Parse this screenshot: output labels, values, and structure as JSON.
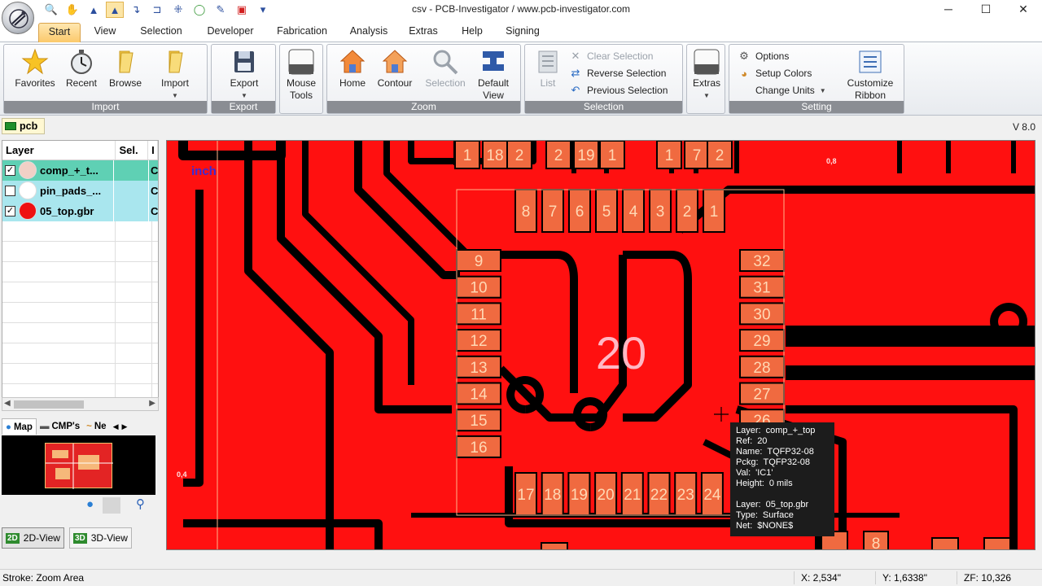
{
  "window": {
    "title": "csv - PCB-Investigator  /  www.pcb-investigator.com",
    "controls": {
      "minimize": "─",
      "maximize": "☐",
      "close": "✕"
    }
  },
  "quick_access": [
    {
      "name": "zoom-icon",
      "glyph": "🔍"
    },
    {
      "name": "pan-hand-icon",
      "glyph": "✋"
    },
    {
      "name": "arrow-up-icon",
      "glyph": "▲"
    },
    {
      "name": "select-arrow-icon",
      "glyph": "▲"
    },
    {
      "name": "route-icon",
      "glyph": "↴"
    },
    {
      "name": "measure-icon",
      "glyph": "⊐"
    },
    {
      "name": "pad-icon",
      "glyph": "⁜"
    },
    {
      "name": "circle-icon",
      "glyph": "◯"
    },
    {
      "name": "pen-icon",
      "glyph": "✎"
    },
    {
      "name": "pdf-icon",
      "glyph": "▣"
    },
    {
      "name": "customize-qat-icon",
      "glyph": "▾"
    }
  ],
  "ribbon_tabs": [
    "Start",
    "View",
    "Selection",
    "Developer",
    "Fabrication",
    "Analysis",
    "Extras",
    "Help",
    "Signing"
  ],
  "ribbon": {
    "import_group": {
      "caption": "Import",
      "favorites": "Favorites",
      "recent": "Recent",
      "browse": "Browse",
      "import": "Import"
    },
    "export_group": {
      "caption": "Export",
      "export": "Export"
    },
    "mouse_group": {
      "line1": "Mouse",
      "line2": "Tools"
    },
    "zoom_group": {
      "caption": "Zoom",
      "home": "Home",
      "contour": "Contour",
      "selection": "Selection",
      "default_view_1": "Default",
      "default_view_2": "View"
    },
    "selection_group": {
      "caption": "Selection",
      "list": "List",
      "clear": "Clear Selection",
      "reverse": "Reverse Selection",
      "previous": "Previous Selection"
    },
    "extras_group": {
      "extras": "Extras"
    },
    "setting_group": {
      "caption": "Setting",
      "options": "Options",
      "setup_colors": "Setup Colors",
      "change_units": "Change Units",
      "customize_1": "Customize",
      "customize_2": "Ribbon"
    }
  },
  "doc_tab": "pcb",
  "version": "V 8.0",
  "layer_grid": {
    "headers": [
      "Layer",
      "Sel.",
      "I"
    ],
    "rows": [
      {
        "checked": true,
        "name": "comp_+_t...",
        "sel": "",
        "i": "C",
        "color": "#f0d0c6",
        "row_bg": "#5fd0b4"
      },
      {
        "checked": false,
        "name": "pin_pads_...",
        "sel": "",
        "i": "C",
        "color": "#ffffff",
        "row_bg": "#a9e6ee"
      },
      {
        "checked": true,
        "name": "05_top.gbr",
        "sel": "",
        "i": "C",
        "color": "#ee1111",
        "row_bg": "#a9e6ee"
      }
    ]
  },
  "panel_tabs": [
    "Map",
    "CMP's",
    "Ne"
  ],
  "view_buttons": [
    {
      "icon": "2D",
      "label": "2D-View"
    },
    {
      "icon": "3D",
      "label": "3D-View"
    }
  ],
  "canvas": {
    "unit_label": "inch",
    "scale_labels": [
      "0,8",
      "0,4"
    ],
    "component_ref": "20",
    "pins_top": [
      "8",
      "7",
      "6",
      "5",
      "4",
      "3",
      "2",
      "1"
    ],
    "pins_left": [
      "9",
      "10",
      "11",
      "12",
      "13",
      "14",
      "15",
      "16"
    ],
    "pins_bottom": [
      "17",
      "18",
      "19",
      "20",
      "21",
      "22",
      "23",
      "24"
    ],
    "pins_right": [
      "32",
      "31",
      "30",
      "29",
      "28",
      "27",
      "26"
    ],
    "upper_pads": [
      "1",
      "18",
      "2",
      "2",
      "19",
      "1",
      "1",
      "7",
      "2"
    ],
    "lower_pads": [
      "8"
    ]
  },
  "tooltip": [
    {
      "k": "Layer:",
      "v": "comp_+_top"
    },
    {
      "k": "Ref:",
      "v": "20"
    },
    {
      "k": "Name:",
      "v": "TQFP32-08"
    },
    {
      "k": "Pckg:",
      "v": "TQFP32-08"
    },
    {
      "k": "Val:",
      "v": "'IC1'"
    },
    {
      "k": "Height:",
      "v": "0 mils"
    },
    {
      "k": "",
      "v": ""
    },
    {
      "k": "Layer:",
      "v": "05_top.gbr"
    },
    {
      "k": "Type:",
      "v": "Surface"
    },
    {
      "k": "Net:",
      "v": "$NONE$"
    }
  ],
  "status": {
    "mode": "Stroke: Zoom Area",
    "x": "X: 2,534\"",
    "y": "Y: 1,6338\"",
    "zf": "ZF: 10,326"
  },
  "colors": {
    "board": "#ff1010",
    "pad": "#f06a40",
    "pad_text": "#ffd8b4",
    "track_gap": "#000000"
  }
}
